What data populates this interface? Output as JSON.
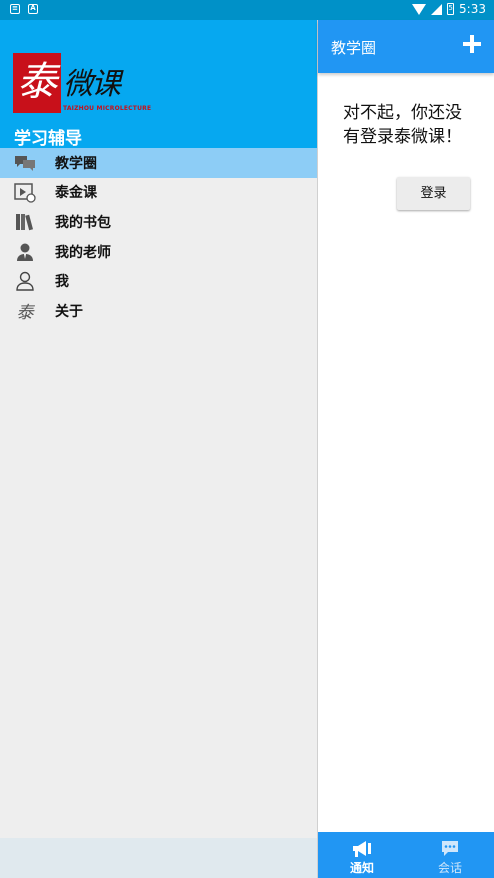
{
  "status_bar": {
    "time": "5:33",
    "battery_level": "5"
  },
  "drawer": {
    "logo_mark": "泰",
    "logo_text": "微课",
    "logo_subtitle": "TAIZHOU MICROLECTURE",
    "title": "学习辅导",
    "items": [
      {
        "label": "教学圈",
        "icon": "chat-bubbles-icon",
        "active": true
      },
      {
        "label": "泰金课",
        "icon": "video-play-icon",
        "active": false
      },
      {
        "label": "我的书包",
        "icon": "books-icon",
        "active": false
      },
      {
        "label": "我的老师",
        "icon": "teacher-icon",
        "active": false
      },
      {
        "label": "我",
        "icon": "person-icon",
        "active": false
      },
      {
        "label": "关于",
        "icon": "tai-logo-icon",
        "active": false
      }
    ]
  },
  "appbar": {
    "title": "教学圈"
  },
  "content": {
    "message": "对不起，你还没有登录泰微课！",
    "login_button": "登录"
  },
  "bottom_nav": [
    {
      "label": "通知",
      "icon": "megaphone-icon",
      "active": true
    },
    {
      "label": "会话",
      "icon": "chat-icon",
      "active": false
    }
  ],
  "colors": {
    "drawer_header": "#06a8f0",
    "appbar": "#2196f3",
    "active_item": "#8dcdf6",
    "logo_red": "#c8101a"
  }
}
